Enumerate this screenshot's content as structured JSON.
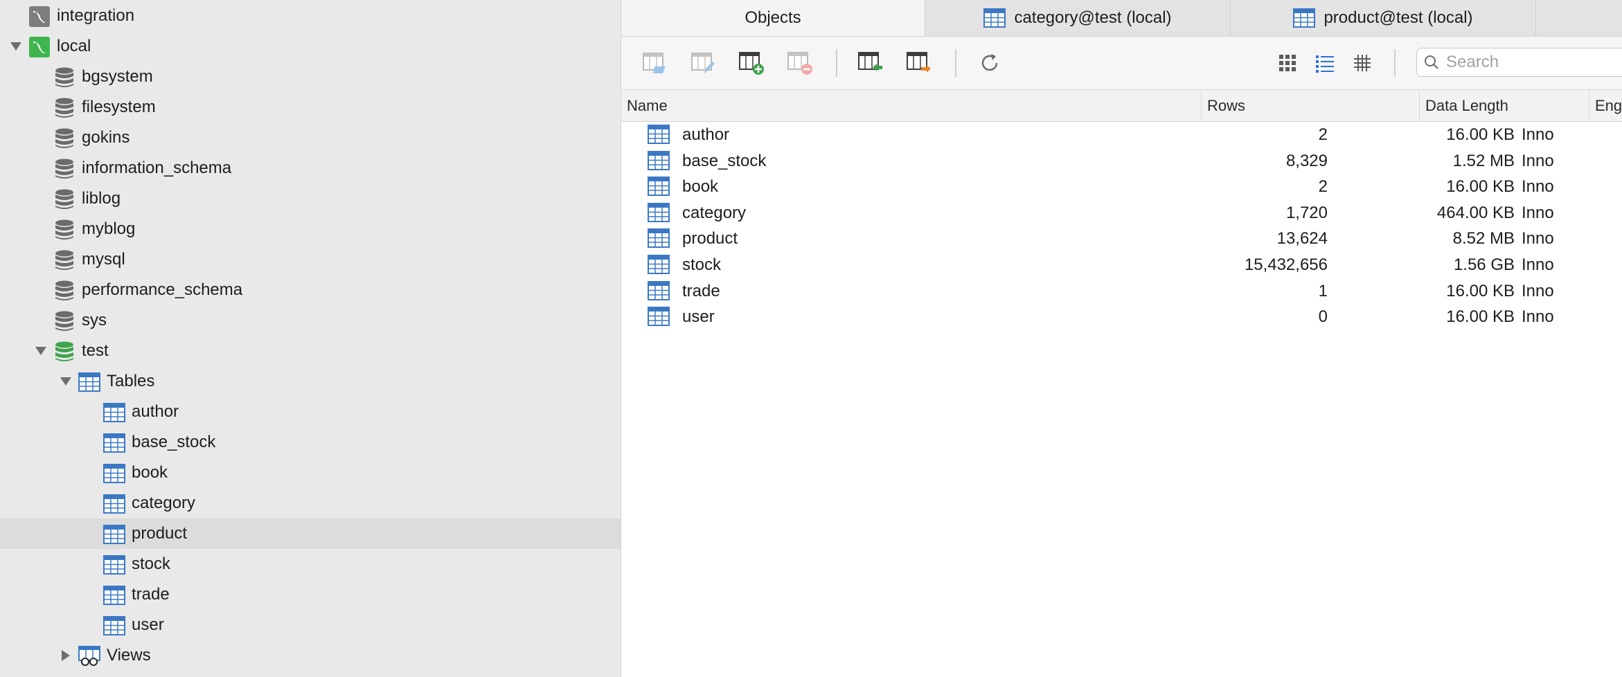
{
  "sidebar": {
    "connections": [
      {
        "label": "integration"
      },
      {
        "label": "local"
      }
    ],
    "databases": [
      {
        "label": "bgsystem"
      },
      {
        "label": "filesystem"
      },
      {
        "label": "gokins"
      },
      {
        "label": "information_schema"
      },
      {
        "label": "liblog"
      },
      {
        "label": "myblog"
      },
      {
        "label": "mysql"
      },
      {
        "label": "performance_schema"
      },
      {
        "label": "sys"
      },
      {
        "label": "test"
      }
    ],
    "tables_group": "Tables",
    "tables": [
      {
        "label": "author"
      },
      {
        "label": "base_stock"
      },
      {
        "label": "book"
      },
      {
        "label": "category"
      },
      {
        "label": "product"
      },
      {
        "label": "stock"
      },
      {
        "label": "trade"
      },
      {
        "label": "user"
      }
    ],
    "views_group": "Views"
  },
  "tabs": [
    {
      "label": "Objects"
    },
    {
      "label": "category@test (local)"
    },
    {
      "label": "product@test (local)"
    }
  ],
  "search": {
    "placeholder": "Search"
  },
  "table": {
    "columns": [
      "Name",
      "Rows",
      "Data Length",
      "Eng"
    ],
    "rows": [
      {
        "name": "author",
        "rows": "2",
        "length": "16.00 KB",
        "engine": "Inno"
      },
      {
        "name": "base_stock",
        "rows": "8,329",
        "length": "1.52 MB",
        "engine": "Inno"
      },
      {
        "name": "book",
        "rows": "2",
        "length": "16.00 KB",
        "engine": "Inno"
      },
      {
        "name": "category",
        "rows": "1,720",
        "length": "464.00 KB",
        "engine": "Inno"
      },
      {
        "name": "product",
        "rows": "13,624",
        "length": "8.52 MB",
        "engine": "Inno"
      },
      {
        "name": "stock",
        "rows": "15,432,656",
        "length": "1.56 GB",
        "engine": "Inno"
      },
      {
        "name": "trade",
        "rows": "1",
        "length": "16.00 KB",
        "engine": "Inno"
      },
      {
        "name": "user",
        "rows": "0",
        "length": "16.00 KB",
        "engine": "Inno"
      }
    ]
  },
  "colors": {
    "sidebar_bg": "#e9e9e9",
    "selected_row": "#dcdcdc",
    "table_icon_blue": "#3b78c4",
    "db_green": "#3fa34d",
    "db_gray": "#6b6b6b"
  }
}
